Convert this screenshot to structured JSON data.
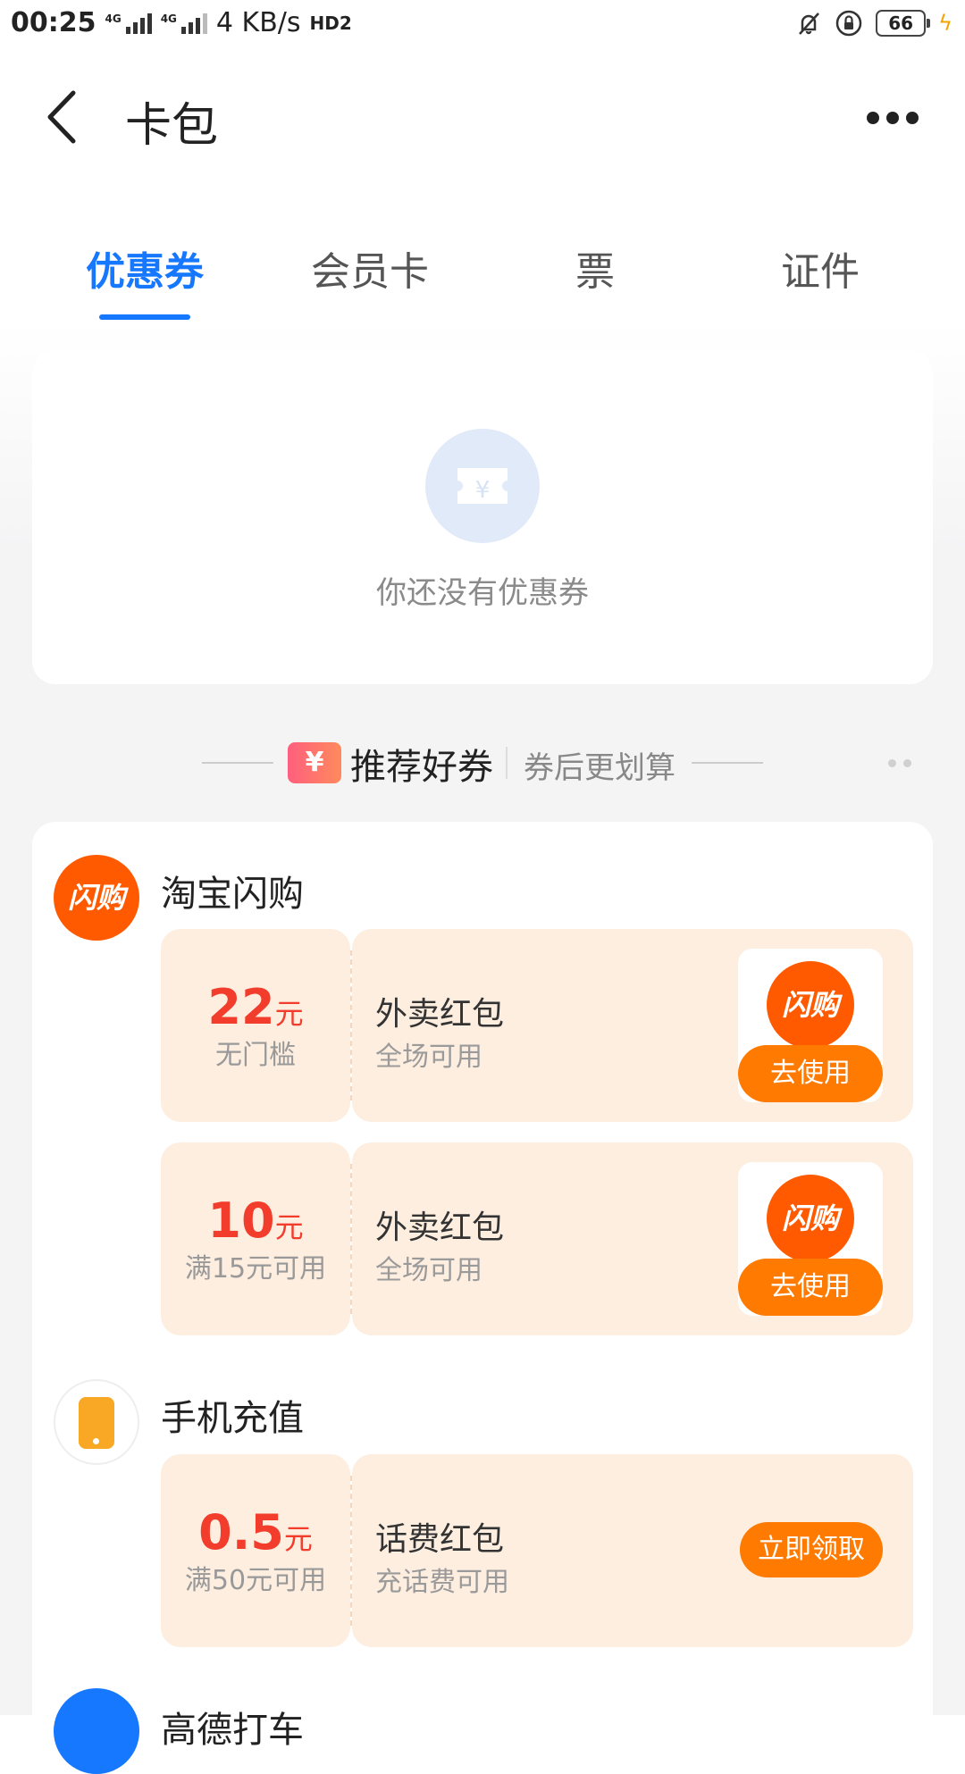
{
  "status_bar": {
    "time": "00:25",
    "net_speed": "4 KB/s",
    "hd": "HD2",
    "battery": "66"
  },
  "nav": {
    "title": "卡包"
  },
  "tabs": [
    {
      "label": "优惠券",
      "active": true
    },
    {
      "label": "会员卡",
      "active": false
    },
    {
      "label": "票",
      "active": false
    },
    {
      "label": "证件",
      "active": false
    }
  ],
  "empty_state": {
    "text": "你还没有优惠券"
  },
  "recommend": {
    "badge": "¥",
    "title": "推荐好券",
    "subtitle": "券后更划算"
  },
  "groups": [
    {
      "brand": "淘宝闪购",
      "logo_text": "闪购",
      "coupons": [
        {
          "amount": "22",
          "unit": "元",
          "condition": "无门槛",
          "title": "外卖红包",
          "desc": "全场可用",
          "thumb_text": "闪购",
          "button": "去使用"
        },
        {
          "amount": "10",
          "unit": "元",
          "condition": "满15元可用",
          "title": "外卖红包",
          "desc": "全场可用",
          "thumb_text": "闪购",
          "button": "去使用"
        }
      ]
    },
    {
      "brand": "手机充值",
      "coupons": [
        {
          "amount": "0.5",
          "unit": "元",
          "condition": "满50元可用",
          "title": "话费红包",
          "desc": "充话费可用",
          "button": "立即领取"
        }
      ]
    },
    {
      "brand": "高德打车"
    }
  ],
  "colors": {
    "accent": "#1677ff",
    "coupon_bg": "#fdeee0",
    "amount": "#f23c2c",
    "button": "#ff7a00",
    "brand_orange": "#ff5a00"
  }
}
